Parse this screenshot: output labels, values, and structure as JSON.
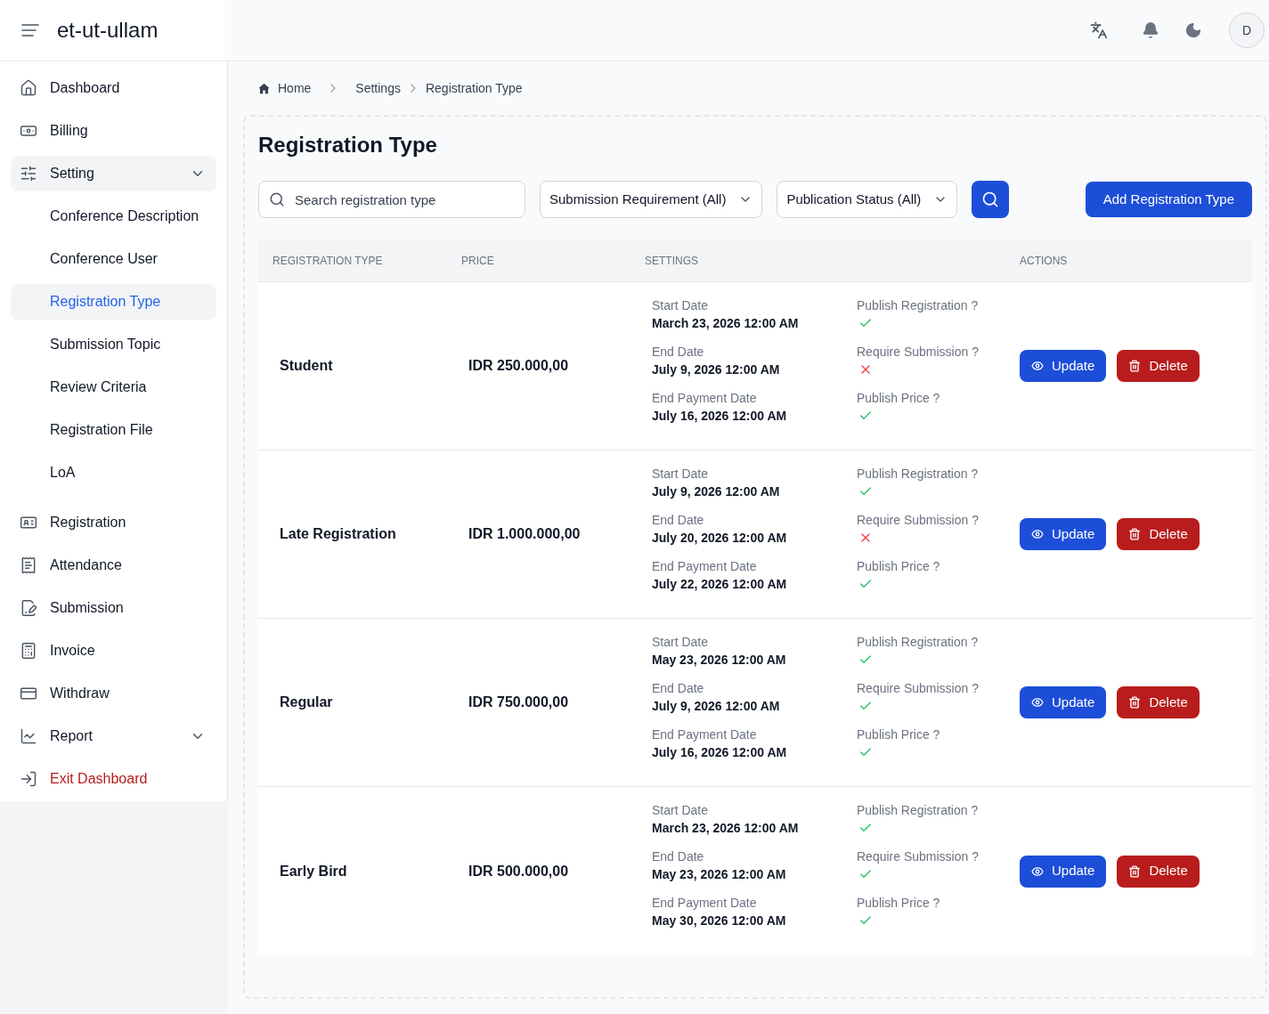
{
  "header": {
    "brand": "et-ut-ullam",
    "avatar": "D"
  },
  "sidebar": {
    "items": [
      {
        "kind": "link",
        "label": "Dashboard",
        "selected": false
      },
      {
        "kind": "link",
        "label": "Billing",
        "selected": false
      },
      {
        "kind": "group",
        "label": "Setting",
        "selected": false,
        "expanded": true,
        "children": [
          {
            "label": "Conference Description",
            "selected": false
          },
          {
            "label": "Conference User",
            "selected": false
          },
          {
            "label": "Registration Type",
            "selected": true
          },
          {
            "label": "Submission Topic",
            "selected": false
          },
          {
            "label": "Review Criteria",
            "selected": false
          },
          {
            "label": "Registration File",
            "selected": false
          },
          {
            "label": "LoA",
            "selected": false
          }
        ]
      },
      {
        "kind": "link",
        "label": "Registration",
        "selected": false
      },
      {
        "kind": "link",
        "label": "Attendance",
        "selected": false
      },
      {
        "kind": "link",
        "label": "Submission",
        "selected": false
      },
      {
        "kind": "link",
        "label": "Invoice",
        "selected": false
      },
      {
        "kind": "link",
        "label": "Withdraw",
        "selected": false
      },
      {
        "kind": "group",
        "label": "Report",
        "selected": false,
        "expanded": false
      },
      {
        "kind": "exit",
        "label": "Exit Dashboard",
        "selected": false
      }
    ]
  },
  "breadcrumb": [
    {
      "label": "Home"
    },
    {
      "label": "Settings"
    },
    {
      "label": "Registration Type"
    }
  ],
  "page": {
    "title": "Registration Type"
  },
  "toolbar": {
    "search": {
      "placeholder": "Search registration type"
    },
    "filters": [
      {
        "value": "Submission Requirement (All)"
      },
      {
        "value": "Publication Status (All)"
      }
    ],
    "add_button": {
      "label": "Add Registration Type"
    }
  },
  "table": {
    "columns": [
      "REGISTRATION TYPE",
      "PRICE",
      "SETTINGS",
      "ACTIONS"
    ],
    "rows": [
      {
        "name": "Student",
        "price": "IDR 250.000,00",
        "dates": [
          {
            "label": "Start Date",
            "value": "March 23, 2026 12:00 AM"
          },
          {
            "label": "End Date",
            "value": "July 9, 2026 12:00 AM"
          },
          {
            "label": "End Payment Date",
            "value": "July 16, 2026 12:00 AM"
          }
        ],
        "flags": [
          {
            "label": "Publish Registration ?",
            "checked": true
          },
          {
            "label": "Require Submission ?",
            "checked": false
          },
          {
            "label": "Publish Price ?",
            "checked": true
          }
        ],
        "actions": [
          {
            "kind": "update",
            "label": "Update"
          },
          {
            "kind": "delete",
            "label": "Delete"
          }
        ]
      },
      {
        "name": "Late Registration",
        "price": "IDR 1.000.000,00",
        "dates": [
          {
            "label": "Start Date",
            "value": "July 9, 2026 12:00 AM"
          },
          {
            "label": "End Date",
            "value": "July 20, 2026 12:00 AM"
          },
          {
            "label": "End Payment Date",
            "value": "July 22, 2026 12:00 AM"
          }
        ],
        "flags": [
          {
            "label": "Publish Registration ?",
            "checked": true
          },
          {
            "label": "Require Submission ?",
            "checked": false
          },
          {
            "label": "Publish Price ?",
            "checked": true
          }
        ],
        "actions": [
          {
            "kind": "update",
            "label": "Update"
          },
          {
            "kind": "delete",
            "label": "Delete"
          }
        ]
      },
      {
        "name": "Regular",
        "price": "IDR 750.000,00",
        "dates": [
          {
            "label": "Start Date",
            "value": "May 23, 2026 12:00 AM"
          },
          {
            "label": "End Date",
            "value": "July 9, 2026 12:00 AM"
          },
          {
            "label": "End Payment Date",
            "value": "July 16, 2026 12:00 AM"
          }
        ],
        "flags": [
          {
            "label": "Publish Registration ?",
            "checked": true
          },
          {
            "label": "Require Submission ?",
            "checked": true
          },
          {
            "label": "Publish Price ?",
            "checked": true
          }
        ],
        "actions": [
          {
            "kind": "update",
            "label": "Update"
          },
          {
            "kind": "delete",
            "label": "Delete"
          }
        ]
      },
      {
        "name": "Early Bird",
        "price": "IDR 500.000,00",
        "dates": [
          {
            "label": "Start Date",
            "value": "March 23, 2026 12:00 AM"
          },
          {
            "label": "End Date",
            "value": "May 23, 2026 12:00 AM"
          },
          {
            "label": "End Payment Date",
            "value": "May 30, 2026 12:00 AM"
          }
        ],
        "flags": [
          {
            "label": "Publish Registration ?",
            "checked": true
          },
          {
            "label": "Require Submission ?",
            "checked": true
          },
          {
            "label": "Publish Price ?",
            "checked": true
          }
        ],
        "actions": [
          {
            "kind": "update",
            "label": "Update"
          },
          {
            "kind": "delete",
            "label": "Delete"
          }
        ]
      }
    ]
  }
}
